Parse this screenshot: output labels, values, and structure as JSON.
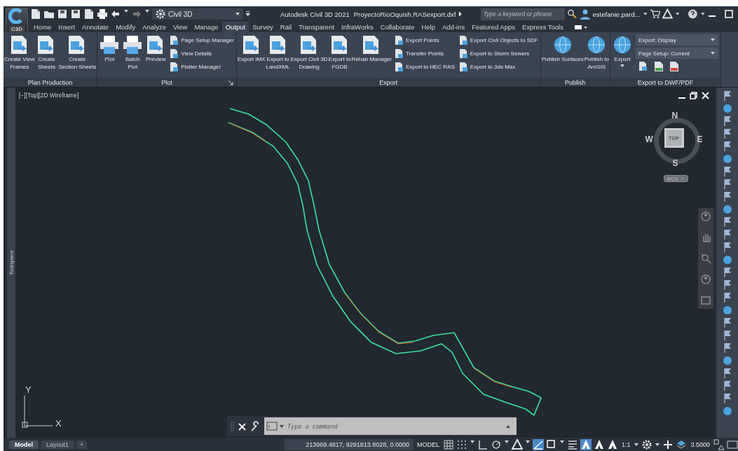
{
  "app_button": {
    "badge": "C3D"
  },
  "quick_access": {
    "workspace": "Civil 3D"
  },
  "title_bar": {
    "app_title": "Autodesk Civil 3D 2021",
    "file_name": "ProyectoRioOquish.RASexport.dxf",
    "search": {
      "placeholder": "Type a keyword or phrase"
    },
    "user": "estefanie.pard..."
  },
  "tabs": [
    {
      "label": "Home",
      "selected": false
    },
    {
      "label": "Insert",
      "selected": false
    },
    {
      "label": "Annotate",
      "selected": false
    },
    {
      "label": "Modify",
      "selected": false
    },
    {
      "label": "Analyze",
      "selected": false
    },
    {
      "label": "View",
      "selected": false
    },
    {
      "label": "Manage",
      "selected": false
    },
    {
      "label": "Output",
      "selected": true
    },
    {
      "label": "Survey",
      "selected": false
    },
    {
      "label": "Rail",
      "selected": false
    },
    {
      "label": "Transparent",
      "selected": false
    },
    {
      "label": "InfraWorks",
      "selected": false
    },
    {
      "label": "Collaborate",
      "selected": false
    },
    {
      "label": "Help",
      "selected": false
    },
    {
      "label": "Add-ins",
      "selected": false
    },
    {
      "label": "Featured Apps",
      "selected": false
    },
    {
      "label": "Express Tools",
      "selected": false
    }
  ],
  "ribbon": {
    "panels": [
      {
        "title": "Plan Production",
        "tools": [
          {
            "kind": "large",
            "label": "Create View\nFrames"
          },
          {
            "kind": "large",
            "label": "Create\nSheets"
          },
          {
            "kind": "large",
            "label": "Create\nSection Sheets"
          }
        ]
      },
      {
        "title": "Plot",
        "launcher": true,
        "tools": [
          {
            "kind": "large",
            "label": "Plot"
          },
          {
            "kind": "large",
            "label": "Batch\nPlot"
          },
          {
            "kind": "large",
            "label": "Preview"
          },
          {
            "kind": "stack",
            "items": [
              "Page Setup Manager",
              "View Details",
              "Plotter Manager"
            ]
          }
        ]
      },
      {
        "title": "Export",
        "tools": [
          {
            "kind": "large",
            "label": "Export IMX"
          },
          {
            "kind": "large",
            "label": "Export to\nLandXML"
          },
          {
            "kind": "large",
            "label": "Export Civil 3D\nDrawing"
          },
          {
            "kind": "large",
            "label": "Export to\nFGDB"
          },
          {
            "kind": "large",
            "label": "Rehab Manager"
          },
          {
            "kind": "stack",
            "items": [
              "Export Points",
              "Transfer Points",
              "Export to HEC RAS"
            ]
          },
          {
            "kind": "stack",
            "items": [
              "Export Civil Objects to SDF",
              "Export to Storm Sewers",
              "Export to 3ds Max"
            ]
          }
        ]
      },
      {
        "title": "Publish",
        "tools": [
          {
            "kind": "large",
            "label": "Publish Surfaces"
          },
          {
            "kind": "large",
            "label": "Publish to\nArcGIS"
          }
        ]
      },
      {
        "title": "Export to DWF/PDF",
        "tools": [
          {
            "kind": "split",
            "label": "Export"
          },
          {
            "kind": "selects",
            "items": [
              "Export: Display",
              "Page Setup: Current"
            ]
          }
        ]
      }
    ]
  },
  "toolspace": {
    "label": "Toolspace"
  },
  "viewport": {
    "label": "[−][Top][2D Wireframe]",
    "viewcube": {
      "north": "N",
      "south": "S",
      "east": "E",
      "west": "W",
      "face": "TOP",
      "ucs": "WCS"
    },
    "ucs_icon": {
      "x": "X",
      "y": "Y"
    }
  },
  "command_line": {
    "placeholder": "Type a command"
  },
  "layout_tabs": [
    {
      "label": "Model",
      "selected": true
    },
    {
      "label": "Layout1",
      "selected": false
    }
  ],
  "add_layout": "+",
  "status_bar": {
    "coordinates": "213969.4817, 9291813.8028, 0.0000",
    "space": "MODEL",
    "scale": "1:1",
    "lineweight": "3.5000"
  }
}
